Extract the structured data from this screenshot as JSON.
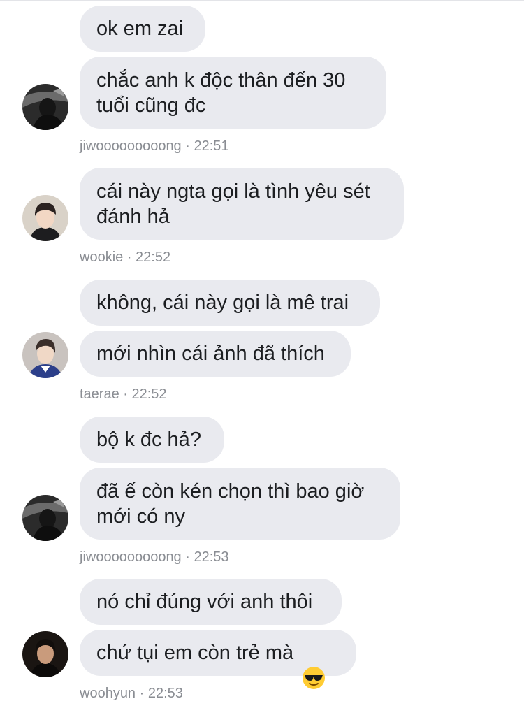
{
  "colors": {
    "bubble_bg": "#e9eaef",
    "text": "#1c1e21",
    "meta_text": "#8a8d93",
    "background": "#ffffff"
  },
  "messages": [
    {
      "text": "ok em zai"
    },
    {
      "text": "chắc anh k độc thân đến 30\ntuổi cũng đc"
    },
    {
      "text": "cái này ngta gọi là tình yêu sét\nđánh hả"
    },
    {
      "text": "không, cái này gọi là mê trai"
    },
    {
      "text": "mới nhìn cái ảnh đã thích"
    },
    {
      "text": "bộ k đc hả?"
    },
    {
      "text": "đã ế còn kén chọn thì bao giờ\nmới có ny"
    },
    {
      "text": "nó chỉ đúng với anh thôi"
    },
    {
      "text": "chứ tụi em còn trẻ mà",
      "emoji": "sunglasses-emoji"
    }
  ],
  "groups": [
    {
      "sender": "jiwooooooooong",
      "time": "22:51",
      "avatar": "dark-photo-avatar"
    },
    {
      "sender": "wookie",
      "time": "22:52",
      "avatar": "portrait-avatar"
    },
    {
      "sender": "taerae",
      "time": "22:52",
      "avatar": "portrait-avatar"
    },
    {
      "sender": "jiwooooooooong",
      "time": "22:53",
      "avatar": "dark-photo-avatar"
    },
    {
      "sender": "woohyun",
      "time": "22:53",
      "avatar": "portrait-avatar"
    }
  ],
  "meta_separator": " · "
}
